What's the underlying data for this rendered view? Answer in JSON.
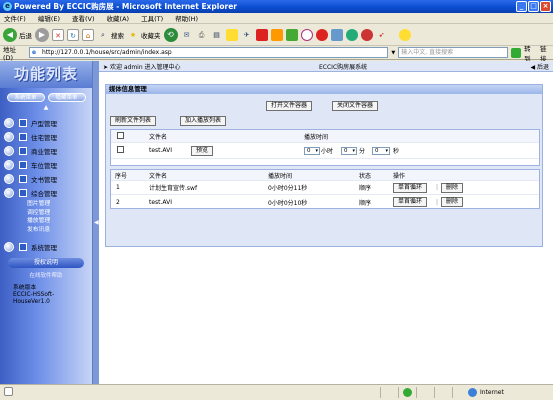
{
  "window": {
    "title": "Powered By ECCIC购房展 - Microsoft Internet Explorer",
    "controls": [
      "_",
      "□",
      "×"
    ]
  },
  "menu": [
    "文件(F)",
    "编辑(E)",
    "查看(V)",
    "收藏(A)",
    "工具(T)",
    "帮助(H)"
  ],
  "toolbar": {
    "back": "后退",
    "search": "搜索",
    "favorites": "收藏夹"
  },
  "address": {
    "label": "地址(D)",
    "url": "http://127.0.0.1/house/src/admin/index.asp",
    "search_placeholder": "输入中文, 直接搜索",
    "go": "转到",
    "links": "链接"
  },
  "sidebar": {
    "title": "功能列表",
    "top_buttons": [
      "系统菜单",
      "隐藏菜单"
    ],
    "sections": [
      {
        "label": "户型管理"
      },
      {
        "label": "住宅管理"
      },
      {
        "label": "商业管理"
      },
      {
        "label": "车位管理"
      },
      {
        "label": "文书管理"
      },
      {
        "label": "综合管理"
      }
    ],
    "sub_items": [
      "图片管理",
      "调控管理",
      "播放管理",
      "发布讯息"
    ],
    "system": "系统管理",
    "cert": "授权说明",
    "cert_sub": "在线软件帮助",
    "version_lines": [
      "系统版本",
      "ECCIC-HSSoft-",
      "HouseVer1.0"
    ]
  },
  "header": {
    "welcome": "欢迎 admin 进入管理中心",
    "center": "ECCIC购房展系统",
    "back": "后退"
  },
  "panel": {
    "title": "媒体信息管理",
    "open_container": "打开文件容器",
    "close_container": "关闭文件容器",
    "refresh_list": "刷新文件列表",
    "add_playlist": "加入播放列表",
    "files_header": {
      "name": "文件名",
      "time": "播放时间"
    },
    "files": [
      {
        "name": "test.AVI",
        "preview": "预览",
        "h": "0",
        "h_unit": "小时",
        "m": "0",
        "m_unit": "分",
        "s": "0",
        "s_unit": "秒"
      }
    ],
    "playlist_header": {
      "seq": "序号",
      "name": "文件名",
      "time": "播放时间",
      "state": "状态",
      "op": "操作"
    },
    "playlist": [
      {
        "seq": "1",
        "name": "计划生育宣传.swf",
        "time": "0小时0分11秒",
        "state": "顺序",
        "loop": "单首循环",
        "del": "删除"
      },
      {
        "seq": "2",
        "name": "test.AVI",
        "time": "0小时0分10秒",
        "state": "顺序",
        "loop": "单首循环",
        "del": "删除"
      }
    ]
  },
  "status": {
    "zone": "Internet"
  }
}
